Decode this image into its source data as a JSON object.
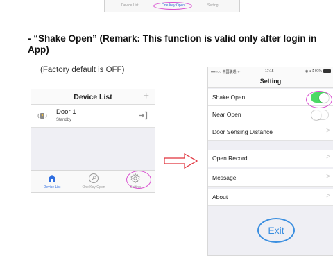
{
  "top_tabs": [
    "Device List",
    "One Key Open",
    "Setting"
  ],
  "heading": "- “Shake Open” (Remark: This function is valid only after login in App)",
  "note": "(Factory default is OFF)",
  "device_list_screen": {
    "title": "Device List",
    "add_symbol": "+",
    "device": {
      "name": "Door 1",
      "status": "Standby"
    },
    "tabs": [
      "Device List",
      "One Key Open",
      "Setting"
    ],
    "active_tab": "Device List"
  },
  "setting_screen": {
    "status_bar": {
      "carrier": "●●○○○ 中国联通 ᯤ",
      "time": "17:15",
      "right": "◉ ● ⁑ 91%"
    },
    "title": "Setting",
    "shake_open": {
      "label": "Shake Open",
      "enabled": true
    },
    "near_open": {
      "label": "Near Open",
      "enabled": false
    },
    "items": [
      "Door Sensing Distance",
      "Open Record",
      "Message",
      "About"
    ],
    "chevron": ">",
    "exit_label": "Exit"
  },
  "colors": {
    "highlight": "#d94fd0",
    "toggle_on": "#4cd964",
    "accent": "#3b8fe0"
  },
  "icons": [
    "door-lock-icon",
    "enter-icon",
    "home-icon",
    "key-icon",
    "gear-icon",
    "arrow-right-icon"
  ]
}
